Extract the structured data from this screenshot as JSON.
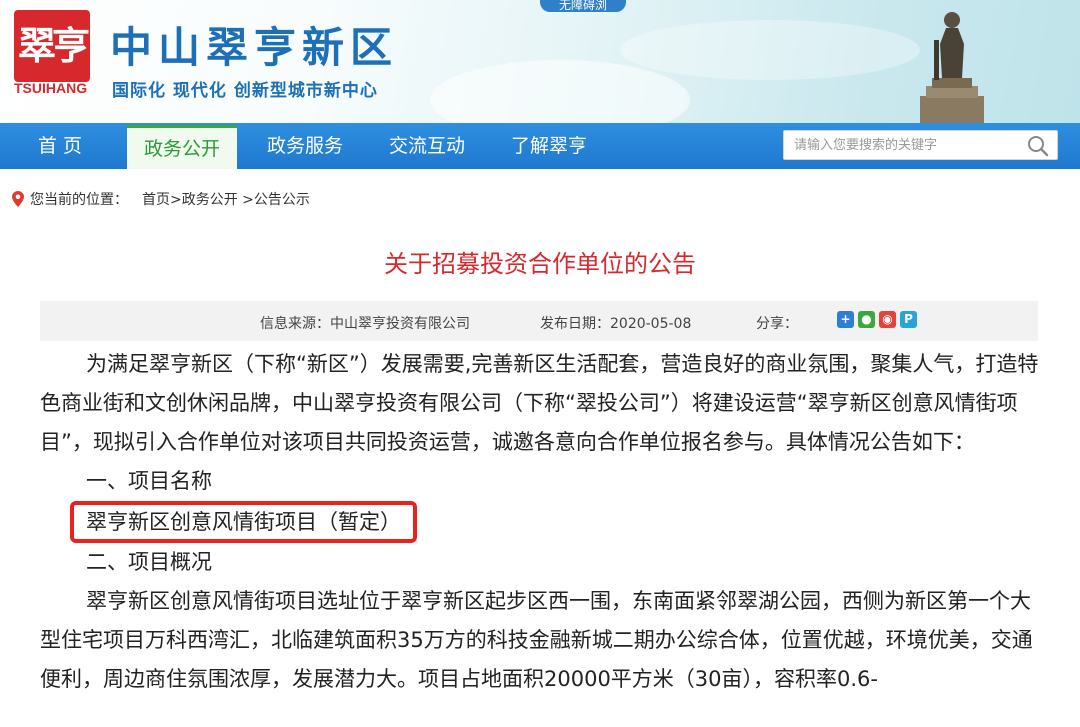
{
  "header": {
    "access_tab": "无障碍浏",
    "logo_cn": "翠亨",
    "logo_en": "TSUIHANG",
    "site_title": "中山翠亨新区",
    "site_slogan": "国际化  现代化  创新型城市新中心"
  },
  "nav": {
    "items": [
      {
        "label": "首  页"
      },
      {
        "label": "政务公开"
      },
      {
        "label": "政务服务"
      },
      {
        "label": "交流互动"
      },
      {
        "label": "了解翠亨"
      }
    ],
    "active_index": 1,
    "search_placeholder": "请输入您要搜索的关键字"
  },
  "breadcrumb": {
    "label": "您当前的位置：",
    "path": "首页>政务公开 >公告公示"
  },
  "article": {
    "title": "关于招募投资合作单位的公告",
    "source": "信息来源：中山翠亨投资有限公司",
    "date": "发布日期：2020-05-08",
    "share_label": "分享：",
    "paragraphs": {
      "p1": "为满足翠亨新区（下称“新区”）发展需要,完善新区生活配套，营造良好的商业氛围，聚集人气，打造特色商业街和文创休闲品牌，中山翠亨投资有限公司（下称“翠投公司”）将建设运营“翠亨新区创意风情街项目”，现拟引入合作单位对该项目共同投资运营，诚邀各意向合作单位报名参与。具体情况公告如下：",
      "h1": "一、项目名称",
      "project_name": "翠亨新区创意风情街项目（暂定）",
      "h2": "二、项目概况",
      "p2": "翠亨新区创意风情街项目选址位于翠亨新区起步区西一围，东南面紧邻翠湖公园，西侧为新区第一个大型住宅项目万科西湾汇，北临建筑面积35万方的科技金融新城二期办公综合体，位置优越，环境优美，交通便利，周边商住氛围浓厚，发展潜力大。项目占地面积20000平方米（30亩），容积率0.6-"
    }
  },
  "colors": {
    "brand_red": "#d7282e",
    "nav_blue": "#2e8fe0",
    "active_green": "#2a9a36",
    "highlight_red": "#e8231f"
  }
}
